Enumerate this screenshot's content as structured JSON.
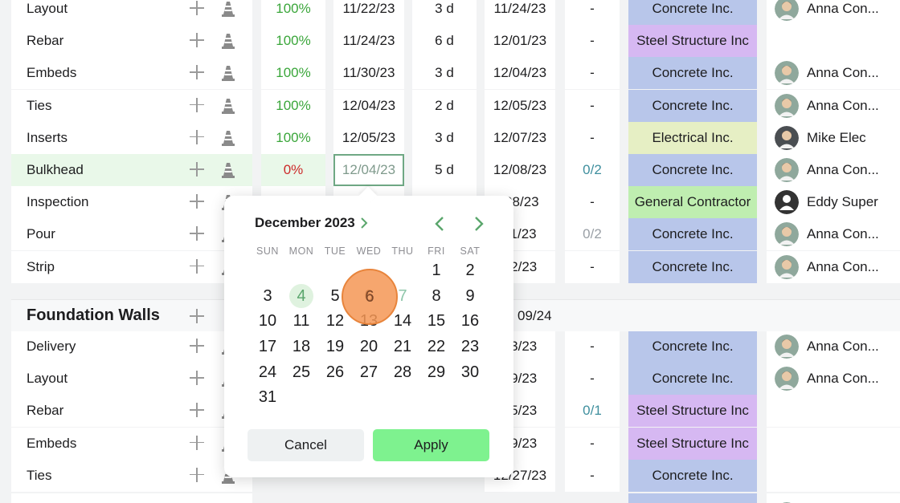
{
  "rows_top": [
    {
      "name": "Layout",
      "pct": "100%",
      "start": "11/22/23",
      "duration": "3 d",
      "end": "11/24/23",
      "check": "-",
      "sub": "Concrete Inc.",
      "sub_type": "concrete",
      "assignee": "Anna Con...",
      "avatar": "photo-avatar"
    },
    {
      "name": "Rebar",
      "pct": "100%",
      "start": "11/24/23",
      "duration": "6 d",
      "end": "12/01/23",
      "check": "-",
      "sub": "Steel Structure Inc",
      "sub_type": "steel",
      "assignee": "",
      "avatar": ""
    },
    {
      "name": "Embeds",
      "pct": "100%",
      "start": "11/30/23",
      "duration": "3 d",
      "end": "12/04/23",
      "check": "-",
      "sub": "Concrete Inc.",
      "sub_type": "concrete",
      "assignee": "Anna Con...",
      "avatar": "photo-avatar"
    },
    {
      "name": "Ties",
      "pct": "100%",
      "start": "12/04/23",
      "duration": "2 d",
      "end": "12/05/23",
      "check": "-",
      "sub": "Concrete Inc.",
      "sub_type": "concrete",
      "assignee": "Anna Con...",
      "avatar": "photo-avatar"
    },
    {
      "name": "Inserts",
      "pct": "100%",
      "start": "12/05/23",
      "duration": "3 d",
      "end": "12/07/23",
      "check": "-",
      "sub": "Electrical Inc.",
      "sub_type": "electrical",
      "assignee": "Mike Elec",
      "avatar": "photo-avatar-dark"
    },
    {
      "name": "Bulkhead",
      "pct": "0%",
      "start": "12/04/23",
      "duration": "5 d",
      "end": "12/08/23",
      "check": "0/2",
      "sub": "Concrete Inc.",
      "sub_type": "concrete",
      "assignee": "Anna Con...",
      "avatar": "photo-avatar"
    },
    {
      "name": "Inspection",
      "pct": "",
      "start": "",
      "duration": "",
      "end": "/08/23",
      "check": "-",
      "sub": "General Contractor",
      "sub_type": "general",
      "assignee": "Eddy Super",
      "avatar": "person-icon"
    },
    {
      "name": "Pour",
      "pct": "",
      "start": "",
      "duration": "",
      "end": "11/23",
      "check": "0/2",
      "sub": "Concrete Inc.",
      "sub_type": "concrete",
      "assignee": "Anna Con...",
      "avatar": "photo-avatar"
    },
    {
      "name": "Strip",
      "pct": "",
      "start": "",
      "duration": "",
      "end": "12/23",
      "check": "-",
      "sub": "Concrete Inc.",
      "sub_type": "concrete",
      "assignee": "Anna Con...",
      "avatar": "photo-avatar"
    }
  ],
  "section": {
    "title": "Foundation Walls",
    "date": "09/24"
  },
  "rows_bottom": [
    {
      "name": "Delivery",
      "end": "13/23",
      "check": "-",
      "sub": "Concrete Inc.",
      "sub_type": "concrete",
      "assignee": "Anna Con...",
      "avatar": "photo-avatar"
    },
    {
      "name": "Layout",
      "end": "19/23",
      "check": "-",
      "sub": "Concrete Inc.",
      "sub_type": "concrete",
      "assignee": "Anna Con...",
      "avatar": "photo-avatar"
    },
    {
      "name": "Rebar",
      "end": "25/23",
      "check": "0/1",
      "sub": "Steel Structure Inc",
      "sub_type": "steel",
      "assignee": "",
      "avatar": ""
    },
    {
      "name": "Embeds",
      "end": "29/23",
      "check": "-",
      "sub": "Steel Structure Inc",
      "sub_type": "steel",
      "assignee": "",
      "avatar": ""
    },
    {
      "name": "Ties",
      "end": "12/27/23",
      "check": "-",
      "sub": "Concrete Inc.",
      "sub_type": "concrete",
      "assignee": "",
      "avatar": ""
    }
  ],
  "datepicker": {
    "month_label": "December 2023",
    "weekdays": [
      "SUN",
      "MON",
      "TUE",
      "WED",
      "THU",
      "FRI",
      "SAT"
    ],
    "leading_blanks": 5,
    "days_in_month": 31,
    "today": 4,
    "clicked": 6,
    "faded": 7,
    "cancel_label": "Cancel",
    "apply_label": "Apply"
  },
  "colors": {
    "apply": "#7ef28f",
    "concrete": "#b8c6ea",
    "steel": "#d6b8f2",
    "electrical": "#e6efc4",
    "general": "#bfeeb0",
    "click_marker": "#f59655"
  }
}
